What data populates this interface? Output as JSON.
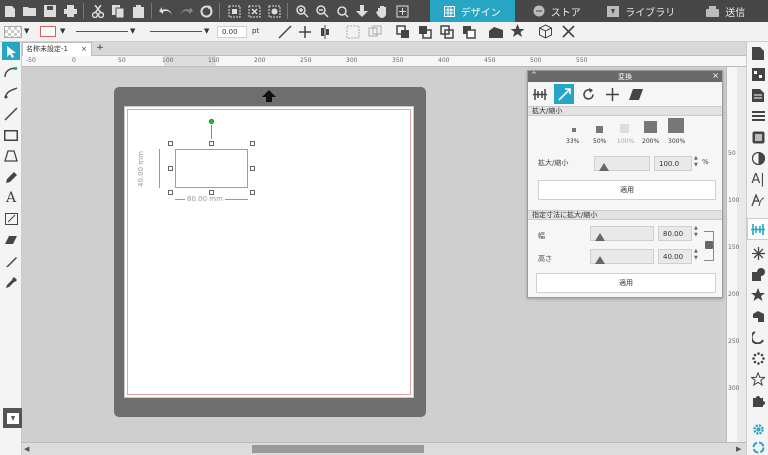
{
  "tabs": [
    {
      "label": "デザイン",
      "icon": "grid-icon"
    },
    {
      "label": "ストア",
      "icon": "store-icon"
    },
    {
      "label": "ライブラリ",
      "icon": "library-icon"
    },
    {
      "label": "送信",
      "icon": "send-icon"
    }
  ],
  "options": {
    "line_width": "0.00",
    "line_unit": "pt"
  },
  "document": {
    "tab_name": "名称未設定-1",
    "close": "×",
    "add": "+"
  },
  "rulers": {
    "h": [
      "-50",
      "0",
      "50",
      "100",
      "150",
      "200",
      "250",
      "300",
      "350",
      "400",
      "450",
      "500",
      "550"
    ],
    "v": [
      "50",
      "100",
      "150",
      "200",
      "250",
      "300"
    ]
  },
  "shape": {
    "width_label": "80.00 mm",
    "height_label": "40.00 mm"
  },
  "panel": {
    "title": "変換",
    "scale_section": "拡大/縮小",
    "presets": [
      "33%",
      "50%",
      "100%",
      "200%",
      "300%"
    ],
    "scale_label": "拡大/縮小",
    "scale_value": "100.0",
    "scale_unit": "%",
    "apply1": "適用",
    "size_section": "指定寸法に拡大/縮小",
    "width_label": "幅",
    "width_value": "80.00",
    "height_label": "高さ",
    "height_value": "40.00",
    "apply2": "適用"
  },
  "colors": {
    "accent": "#27a5c4",
    "topbar": "#4a4a4a",
    "mat": "#6e6e6e"
  }
}
